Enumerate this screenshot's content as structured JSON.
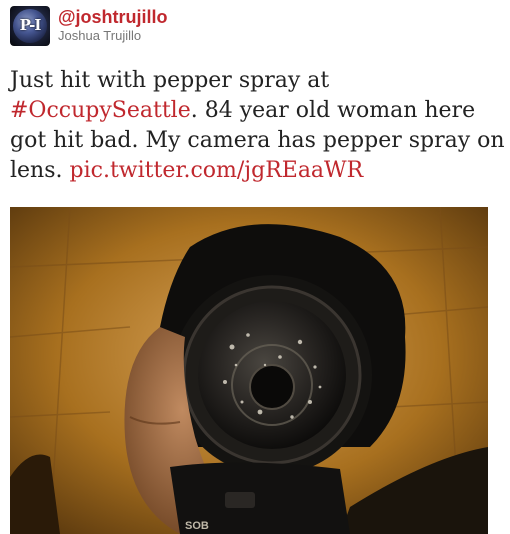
{
  "tweet": {
    "handle": "@joshtrujillo",
    "fullname": "Joshua Trujillo",
    "avatar_text": "P-I",
    "text_part1": "Just hit with pepper spray at ",
    "hashtag": "#OccupySeattle",
    "text_part2": ". 84 year old woman here got hit bad. My camera has pepper spray on lens. ",
    "link": "pic.twitter.com/jgREaaWR",
    "photo_label": "SOB"
  },
  "colors": {
    "link": "#c0282e",
    "text": "#222222",
    "secondary": "#777777"
  }
}
